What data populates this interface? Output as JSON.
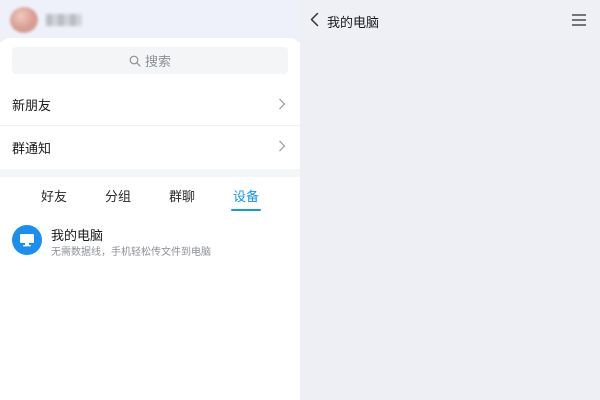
{
  "left": {
    "search": {
      "placeholder": "搜索",
      "icon": "search-icon"
    },
    "rows": [
      {
        "label": "新朋友",
        "icon": "chevron-right-icon"
      },
      {
        "label": "群通知",
        "icon": "chevron-right-icon"
      }
    ],
    "tabs": [
      {
        "label": "好友"
      },
      {
        "label": "分组"
      },
      {
        "label": "群聊"
      },
      {
        "label": "设备"
      }
    ],
    "active_tab": "设备",
    "device": {
      "title": "我的电脑",
      "subtitle": "无需数据线，手机轻松传文件到电脑",
      "icon": "monitor-icon"
    }
  },
  "right": {
    "title": "我的电脑",
    "back_icon": "chevron-left-icon",
    "menu_icon": "hamburger-menu-icon"
  },
  "colors": {
    "accent": "#1296f0",
    "device_icon_bg": "#1a8ff0",
    "panel_bg": "#eeeff4"
  }
}
